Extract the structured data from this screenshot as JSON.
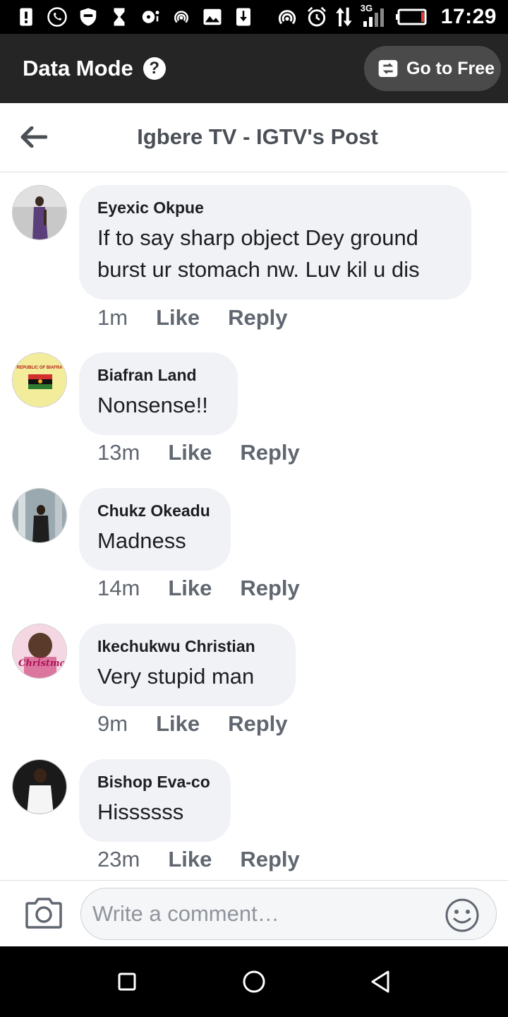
{
  "status_bar": {
    "time": "17:29",
    "network_label": "3G",
    "icons": [
      "alert-icon",
      "whatsapp-icon",
      "shield-icon",
      "hourglass-icon",
      "notification-icon",
      "hotspot-icon",
      "image-icon",
      "download-icon",
      "wifi-tether-icon",
      "alarm-icon",
      "data-arrows-icon",
      "signal-icon",
      "battery-icon"
    ]
  },
  "data_mode": {
    "title": "Data Mode",
    "help_icon": "?",
    "go_free_label": "Go to Free"
  },
  "header": {
    "title": "Igbere TV - IGTV's Post"
  },
  "comments": [
    {
      "author": "Eyexic Okpue",
      "text": "If to say sharp object Dey ground burst ur stomach nw. Luv kil u dis",
      "time": "1m",
      "like_label": "Like",
      "reply_label": "Reply"
    },
    {
      "author": "Biafran Land",
      "text": "Nonsense!!",
      "time": "13m",
      "like_label": "Like",
      "reply_label": "Reply"
    },
    {
      "author": "Chukz Okeadu",
      "text": "Madness",
      "time": "14m",
      "like_label": "Like",
      "reply_label": "Reply"
    },
    {
      "author": "Ikechukwu Christian",
      "text": "Very stupid man",
      "time": "9m",
      "like_label": "Like",
      "reply_label": "Reply"
    },
    {
      "author": "Bishop Eva-co",
      "text": "Hissssss",
      "time": "23m",
      "like_label": "Like",
      "reply_label": "Reply"
    }
  ],
  "avatar_labels": {
    "biafra_top": "REPUBLIC OF BIAFRA",
    "christmas": "Christmas"
  },
  "composer": {
    "placeholder": "Write a comment…"
  },
  "colors": {
    "data_bar_bg": "#252525",
    "bubble_bg": "#f0f2f5",
    "meta_text": "#606770"
  }
}
